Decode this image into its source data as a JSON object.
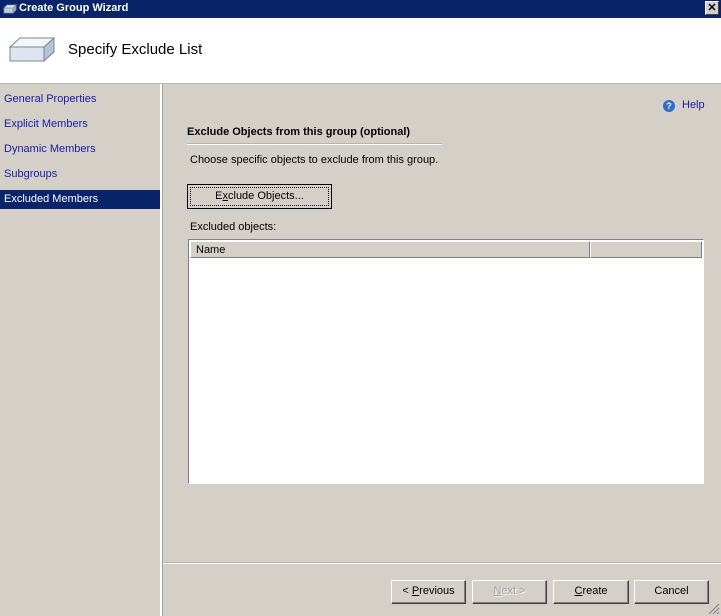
{
  "window": {
    "title": "Create Group Wizard",
    "close_glyph": "✕"
  },
  "header": {
    "title": "Specify Exclude List",
    "icon": "wizard-box-icon"
  },
  "sidebar": {
    "items": [
      {
        "label": "General Properties",
        "selected": false
      },
      {
        "label": "Explicit Members",
        "selected": false
      },
      {
        "label": "Dynamic Members",
        "selected": false
      },
      {
        "label": "Subgroups",
        "selected": false
      },
      {
        "label": "Excluded Members",
        "selected": true
      }
    ]
  },
  "help": {
    "label": "Help",
    "glyph": "?"
  },
  "main": {
    "section_title": "Exclude Objects from this group  (optional)",
    "description": "Choose specific objects to exclude from this group.",
    "exclude_button": {
      "pre": "E",
      "mnemonic": "x",
      "post": "clude Objects..."
    },
    "excluded_label": "Excluded objects:",
    "list": {
      "columns": [
        "Name",
        ""
      ],
      "rows": []
    }
  },
  "footer": {
    "previous": {
      "pre": "< ",
      "mnemonic": "P",
      "post": "revious"
    },
    "next": {
      "pre": "",
      "mnemonic": "N",
      "post": "ext >",
      "disabled": true
    },
    "create": {
      "pre": "",
      "mnemonic": "C",
      "post": "reate"
    },
    "cancel": "Cancel"
  }
}
